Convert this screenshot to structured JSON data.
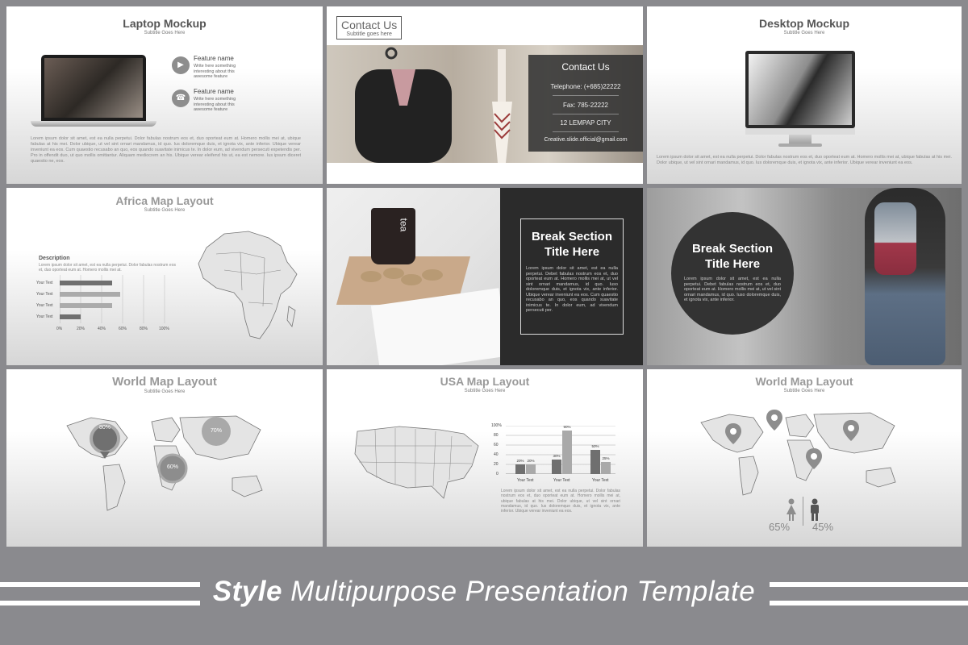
{
  "slides": {
    "laptop": {
      "title": "Laptop Mockup",
      "subtitle": "Subtitle Goes Here",
      "features": [
        {
          "title": "Feature name",
          "text": "Write here something interesting about this awesome feature"
        },
        {
          "title": "Feature name",
          "text": "Write here something interesting about this awesome feature"
        }
      ],
      "body": "Lorem ipsum dolor sit amet, est ea nulla perpetui. Dolor fabulas nostrum eos et, duo oporteat eum at. Homero mollis mei at, ubique fabulas at his mei. Dolor ubique, ut vel sint ornari mandamus, id quo. Ius doloremque duis, et ignota vix, ante inferior. Ubique verear inveniunt ea eos. Cum quaestio recusabo an quo, eos quando suavitate inimicus te. In dolor eum, ad vivendum persecuti expetendis per. Pro in offendit duo, ut quo mollis omittantur. Aliquam mediocrem an his. Ubique verear eleifend his ut, ea est nemore. Ius ipsum diceret quaestio ne, eos."
    },
    "contact": {
      "box_title": "Contact Us",
      "box_subtitle": "Subtitle goes here",
      "panel_title": "Contact Us",
      "telephone": "Telephone: (+685)22222",
      "fax": "Fax: 785-22222",
      "address": "12  LEMPAP CITY",
      "email": "Creative.slide.official@gmail.com"
    },
    "desktop": {
      "title": "Desktop Mockup",
      "subtitle": "Subtitle Goes Here",
      "body": "Lorem ipsum dolor sit amet, est ea nulla perpetui. Dolor fabulas nostrum eos et, duo oporteat eum at. Homero mollis mei at, ubique fabulas at his mei. Dolor ubique, ut vel sint ornari mandamus, id quo. Ius doloremque duis, et ignota vix, ante inferior. Ubique verear inveniunt ea eos."
    },
    "africa": {
      "title": "Africa Map Layout",
      "subtitle": "Subtitle Goes Here",
      "desc_title": "Description",
      "desc_text": "Lorem ipsum dolor sit amet, est ea nulla perpetui. Dolor fabulas nostrum eos et, duo oporteat eum at. Homero mollis mei at.",
      "row_labels": [
        "Your Text",
        "Your Text",
        "Your Text",
        "Your Text"
      ],
      "ticks": [
        "0%",
        "20%",
        "40%",
        "60%",
        "80%",
        "100%"
      ]
    },
    "break1": {
      "title_line1": "Break Section",
      "title_line2": "Title Here",
      "mug_text": "tea",
      "text": "Lorem ipsum dolor sit amet, est ea nulla perpetui. Debet fabulas nostrum eos et, duo oporteat eum at. Homero mollis mei at, ut vel sint ornari mandamus, id quo. Iuso doloremque duis, et ignota vix, ante inferior. Ubique verear inveniunt ea eos. Cum quaestio recusabo an quo, eos quando suavitate inimicus te. In dolor eum, ad vivendum persecuti per."
    },
    "break2": {
      "title_line1": "Break Section",
      "title_line2": "Title Here",
      "text": "Lorem ipsum dolor sit amet, est ea nulla perpetui. Debet fabulas nostrum eos et, duo oporteat eum at. Homero mollis mei at, ut vel sint ornari mandamus, id quo. Iuso doloremque duis, et ignota vix, ante inferior."
    },
    "world1": {
      "title": "World Map Layout",
      "subtitle": "Subtitle Goes Here",
      "bubbles": [
        "80%",
        "70%",
        "60%"
      ]
    },
    "usa": {
      "title": "USA Map Layout",
      "subtitle": "Subtitle Goes Here",
      "body": "Lorem ipsum dolor sit amet, est ea nulla perpetui. Dolor fabulas nostrum eos et, duo oporteat eum at. Homero mollis mei at, ubique fabulas at his mei. Dolor ubique, ut vel sint ornari mandamus, id quo. Ius doloremque duis, et ignota vix, ante inferior. Ubique verear inveniunt ea eos."
    },
    "world2": {
      "title": "World Map Layout",
      "subtitle": "Subtitle Goes Here",
      "female_pct": "65%",
      "male_pct": "45%"
    }
  },
  "footer": {
    "bold": "Style",
    "rest": " Multipurpose Presentation Template"
  },
  "colors": {
    "background": "#8a8a8e",
    "dark_panel": "#2b2b2b",
    "bar_dark": "#6f6f6f",
    "bar_light": "#a9a9a9"
  },
  "chart_data": [
    {
      "type": "bar",
      "orientation": "horizontal",
      "categories": [
        "Your Text",
        "Your Text",
        "Your Text",
        "Your Text"
      ],
      "values": [
        50,
        58,
        50,
        20
      ],
      "xlim": [
        0,
        100
      ],
      "tick_labels": [
        "0%",
        "20%",
        "40%",
        "60%",
        "80%",
        "100%"
      ]
    },
    {
      "type": "bar",
      "categories": [
        "Your Text",
        "Your Text",
        "Your Text"
      ],
      "series": [
        {
          "values": [
            20,
            30,
            50
          ]
        },
        {
          "values": [
            20,
            90,
            25
          ]
        }
      ],
      "data_labels": [
        [
          "20%",
          "30%",
          "50%"
        ],
        [
          "20%",
          "90%",
          "25%"
        ]
      ],
      "ylim": [
        0,
        100
      ],
      "tick_labels": [
        "100%",
        "80",
        "60",
        "40",
        "20",
        "0"
      ]
    }
  ]
}
